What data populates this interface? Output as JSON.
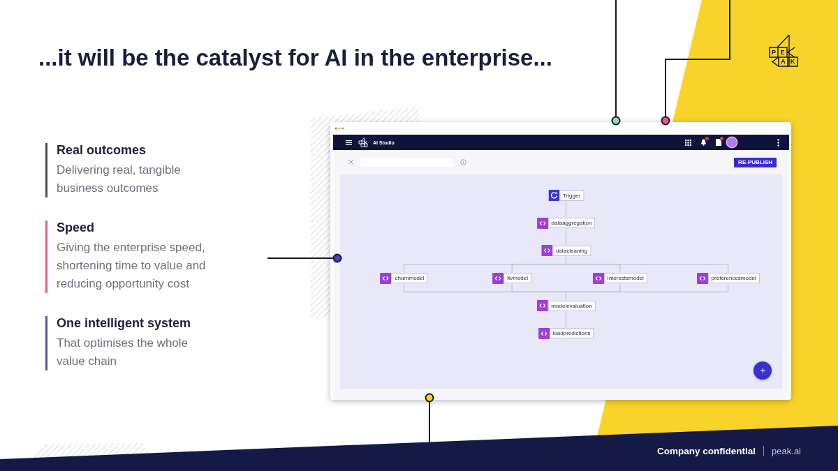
{
  "title": "...it will be the catalyst for AI in the enterprise...",
  "logo": {
    "letters": [
      "P",
      "E",
      "A",
      "K"
    ]
  },
  "features": [
    {
      "title": "Real outcomes",
      "description": "Delivering real, tangible business outcomes",
      "color": "#4b4b57"
    },
    {
      "title": "Speed",
      "description": "Giving the enterprise speed, shortening time to value and reducing opportunity cost",
      "color": "#e0618f"
    },
    {
      "title": "One intelligent system",
      "description": "That optimises the whole value chain",
      "color": "#5656a6"
    }
  ],
  "app_window": {
    "navbar": {
      "title": "AI Studio",
      "icons": [
        {
          "kind": "grid",
          "badge": false
        },
        {
          "kind": "bell",
          "badge": true
        },
        {
          "kind": "document",
          "badge": true
        },
        {
          "kind": "avatar",
          "badge": false
        },
        {
          "kind": "more",
          "badge": false
        }
      ]
    },
    "toolbar": {
      "button": "RE-PUBLISH"
    },
    "workflow": {
      "rows": [
        {
          "nodes": [
            {
              "kind": "trigger",
              "label": "Trigger"
            }
          ]
        },
        {
          "nodes": [
            {
              "kind": "script",
              "label": "dataaggregation"
            }
          ]
        },
        {
          "nodes": [
            {
              "kind": "script",
              "label": "datacleaning"
            }
          ]
        },
        {
          "nodes": [
            {
              "kind": "script",
              "label": "churnmodel"
            },
            {
              "kind": "script",
              "label": "ltvmodel"
            },
            {
              "kind": "script",
              "label": "interestsmodel"
            },
            {
              "kind": "script",
              "label": "preferencesmodel"
            }
          ]
        },
        {
          "nodes": [
            {
              "kind": "script",
              "label": "modelevaluation"
            }
          ]
        },
        {
          "nodes": [
            {
              "kind": "script",
              "label": "loadpredictions"
            }
          ]
        }
      ]
    }
  },
  "footer": {
    "text": "Company confidential",
    "link": "peak.ai"
  }
}
